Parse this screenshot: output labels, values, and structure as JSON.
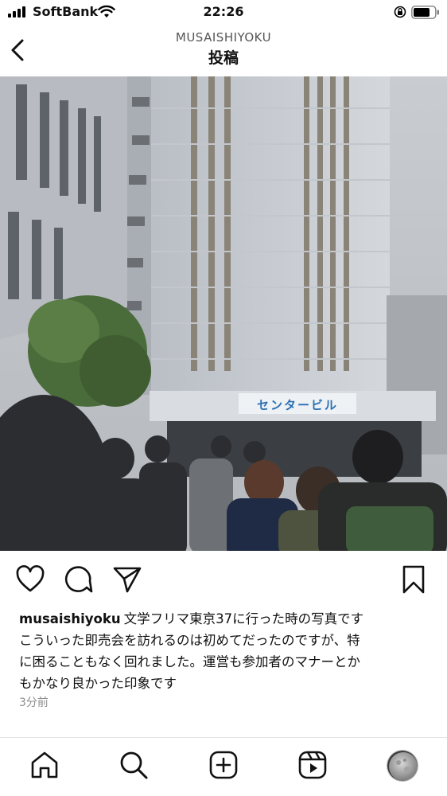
{
  "status_bar": {
    "carrier": "SoftBank",
    "time": "22:26",
    "icons": [
      "signal-icon",
      "wifi-icon",
      "orientation-lock-icon",
      "battery-icon"
    ]
  },
  "header": {
    "account": "MUSAISHIYOKU",
    "title": "投稿",
    "back_icon": "chevron-left-icon"
  },
  "photo": {
    "sign_text": "センタービル",
    "description_icon": "post-photo"
  },
  "actions": {
    "icons": [
      "heart-icon",
      "comment-icon",
      "share-icon",
      "bookmark-icon"
    ]
  },
  "caption": {
    "username": "musaishiyoku",
    "line1": "文学フリマ東京37に行った時の写真です",
    "line2": "こういった即売会を訪れるのは初めてだったのですが、特",
    "line3": "に困ることもなく回れました。運営も参加者のマナーとか",
    "line4": "もかなり良かった印象です",
    "timestamp": "3分前"
  },
  "bottom_nav": {
    "items": [
      "home-icon",
      "search-icon",
      "create-post-icon",
      "reels-icon",
      "profile-avatar"
    ]
  },
  "colors": {
    "text": "#111111",
    "muted": "#8e8e8e",
    "sign_blue": "#2c6fb3"
  }
}
